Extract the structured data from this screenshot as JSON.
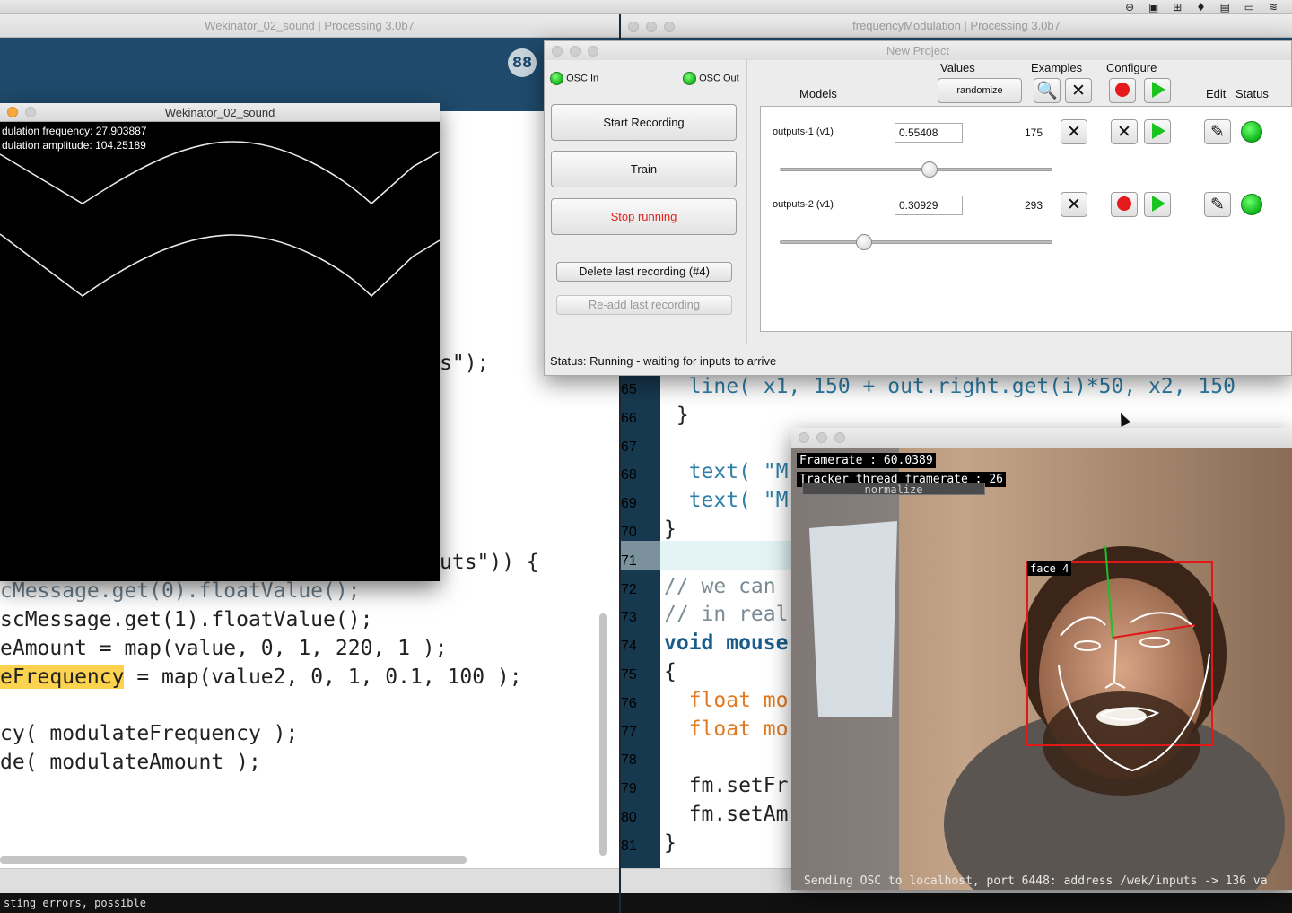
{
  "menubar": {
    "status_icons": "⊖ ▣ ⊞ ♦ ▤ ▭ ≋"
  },
  "left_window": {
    "title": "Wekinator_02_sound | Processing 3.0b7",
    "mode_glyph": "88",
    "code_lines": [
      "s\");",
      "uts\")) {",
      "cMessage.get(0).floatValue();",
      "scMessage.get(1).floatValue();",
      "eAmount = map(value, 0, 1, 220, 1 );",
      "eFrequency = map(value2, 0, 1, 0.1, 100 );",
      "",
      "cy( modulateFrequency );",
      "de( modulateAmount );"
    ],
    "console": "sting errors, possible"
  },
  "right_window": {
    "title": "frequencyModulation | Processing 3.0b7",
    "line_numbers": [
      "65",
      "66",
      "67",
      "68",
      "69",
      "70",
      "71",
      "72",
      "73",
      "74",
      "75",
      "76",
      "77",
      "78",
      "79",
      "80",
      "81"
    ],
    "code_lines": [
      "  line( x1, 150 + out.right.get(i)*50, x2, 150",
      " }",
      "",
      "  text( \"M",
      "  text( \"M",
      "}",
      "",
      "// we can",
      "// in real",
      "void mouse",
      "{",
      "  float mo",
      "  float mo",
      "",
      "  fm.setFr",
      "  fm.setAm",
      "}"
    ]
  },
  "sketch": {
    "title": "Wekinator_02_sound",
    "line1": "dulation frequency: 27.903887",
    "line2": "dulation amplitude: 104.25189"
  },
  "wekinator": {
    "title": "New Project",
    "osc_in": "OSC In",
    "osc_out": "OSC Out",
    "start_recording": "Start Recording",
    "train": "Train",
    "stop_running": "Stop running",
    "delete_last": "Delete last recording (#4)",
    "readd_last": "Re-add last recording",
    "headers": {
      "values": "Values",
      "examples": "Examples",
      "configure": "Configure",
      "models": "Models",
      "edit": "Edit",
      "status": "Status"
    },
    "randomize": "randomize",
    "search_glyph": "🔍",
    "x_glyph": "✕",
    "edit_glyph": "✎",
    "models": [
      {
        "name": "outputs-1 (v1)",
        "value": "0.55408",
        "examples": "175",
        "slider": 0.55
      },
      {
        "name": "outputs-2 (v1)",
        "value": "0.30929",
        "examples": "293",
        "slider": 0.31
      }
    ],
    "status_line": "Status:  Running - waiting for inputs to arrive"
  },
  "facetracker": {
    "framerate": "Framerate : 60.0389",
    "tracker_framerate": "Tracker thread framerate : 26",
    "normalize": "normalize",
    "face_label": "face 4",
    "footer": "Sending OSC to localhost, port 6448: address /wek/inputs -> 136 va"
  }
}
